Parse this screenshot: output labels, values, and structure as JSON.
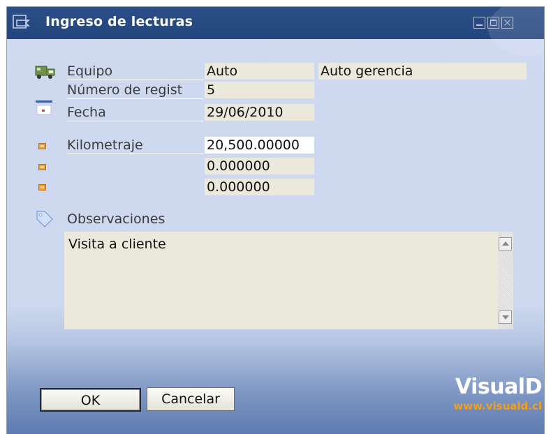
{
  "window": {
    "title": "Ingreso de lecturas"
  },
  "form": {
    "equipo": {
      "label": "Equipo",
      "code": "Auto",
      "description": "Auto gerencia"
    },
    "numero_registro": {
      "label": "Número de regist",
      "value": "5"
    },
    "fecha": {
      "label": "Fecha",
      "value": "29/06/2010"
    },
    "kilometraje": {
      "label": "Kilometraje",
      "value": "20,500.00000"
    },
    "extra_reading_1": {
      "value": "0.000000"
    },
    "extra_reading_2": {
      "value": "0.000000"
    },
    "observaciones": {
      "label": "Observaciones",
      "value": "Visita a cliente"
    }
  },
  "buttons": {
    "ok_label": "OK",
    "cancel_label": "Cancelar"
  },
  "branding": {
    "logo_text": "VisualD",
    "url_text": "www.visuald.cl"
  },
  "icons": {
    "title": "form-window-icon",
    "equipo": "truck-icon",
    "fecha": "calendar-icon",
    "readings": "orange-bullet-icon",
    "observaciones": "tag-icon"
  },
  "colors": {
    "titlebar": "#24467f",
    "window_bg": "#cfd9ef",
    "field_bg": "#ebe8dc",
    "logo_url": "#f0a020"
  }
}
